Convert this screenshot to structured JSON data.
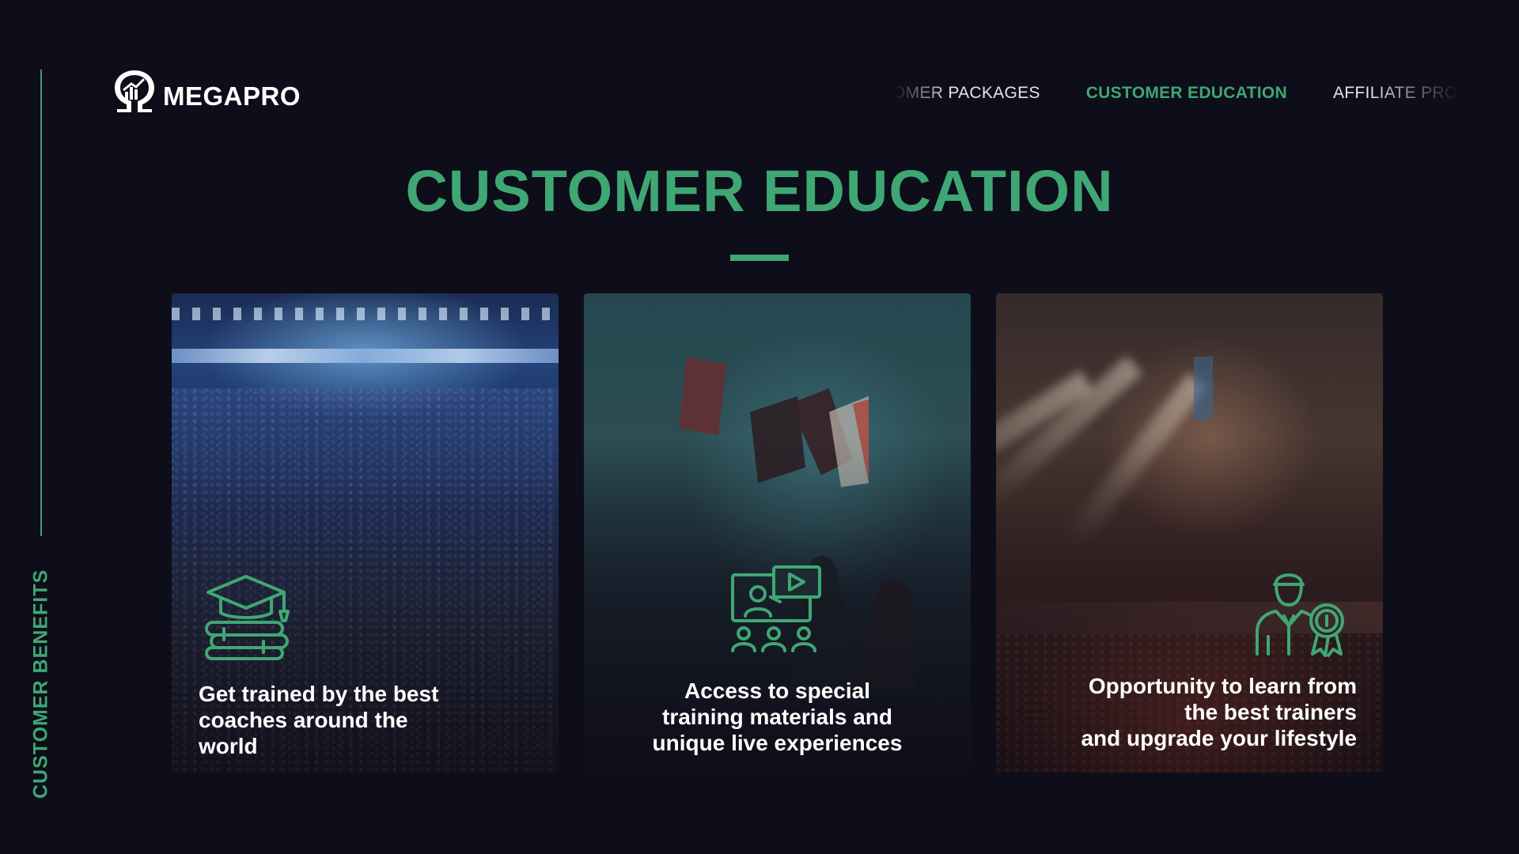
{
  "brand": {
    "logo_text": "MEGAPRO",
    "accent_color": "#3fa774",
    "background_color": "#0e0d1a"
  },
  "side": {
    "label": "CUSTOMER BENEFITS"
  },
  "nav": {
    "items": [
      {
        "label": "CUSTOMER PACKAGES",
        "active": false
      },
      {
        "label": "CUSTOMER EDUCATION",
        "active": true
      },
      {
        "label": "AFFILIATE PROGRAM",
        "active": false
      }
    ]
  },
  "main": {
    "title": "CUSTOMER EDUCATION",
    "cards": [
      {
        "icon": "graduation-cap-books-icon",
        "text": "Get trained by the best\ncoaches around the\nworld"
      },
      {
        "icon": "video-training-icon",
        "text": "Access to special\ntraining materials and\nunique live experiences"
      },
      {
        "icon": "trainer-award-icon",
        "text": "Opportunity to learn from\nthe best trainers\nand upgrade your lifestyle"
      }
    ]
  }
}
